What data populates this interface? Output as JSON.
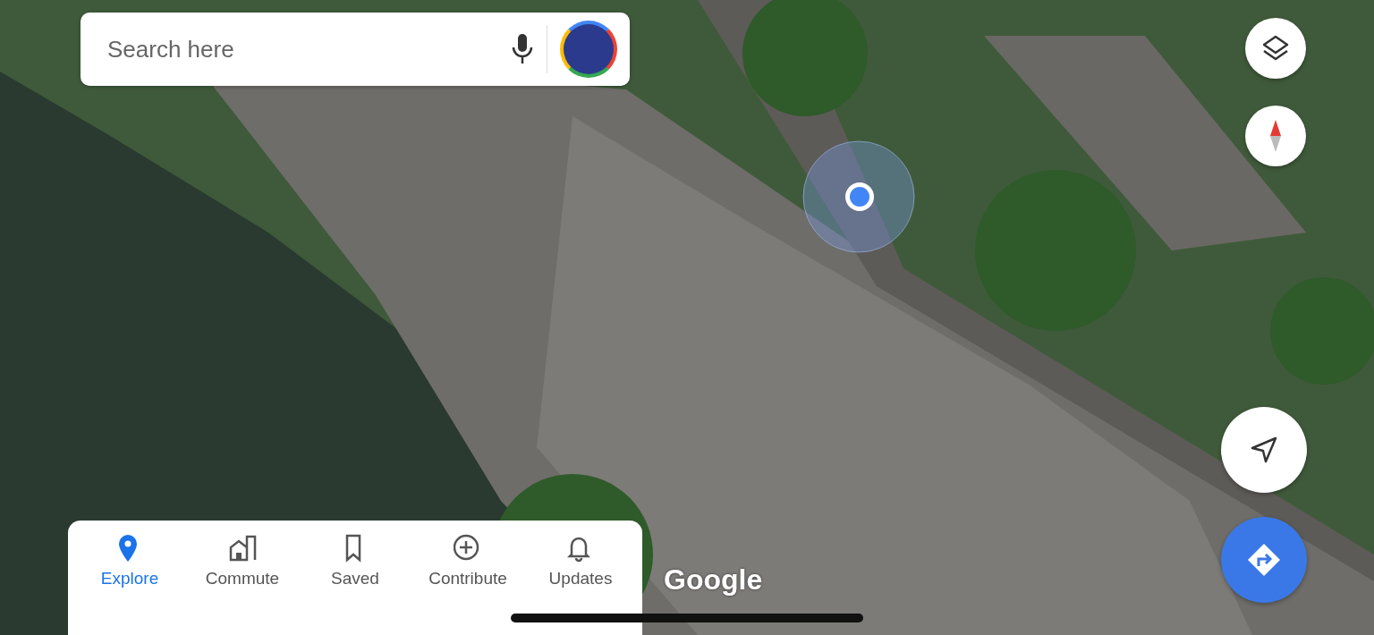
{
  "search": {
    "placeholder": "Search here"
  },
  "nav": [
    {
      "label": "Explore",
      "selected": true,
      "kind": "pin"
    },
    {
      "label": "Commute",
      "selected": false,
      "kind": "commute"
    },
    {
      "label": "Saved",
      "selected": false,
      "kind": "saved"
    },
    {
      "label": "Contribute",
      "selected": false,
      "kind": "contribute"
    },
    {
      "label": "Updates",
      "selected": false,
      "kind": "updates"
    }
  ],
  "map_logo": "Google"
}
